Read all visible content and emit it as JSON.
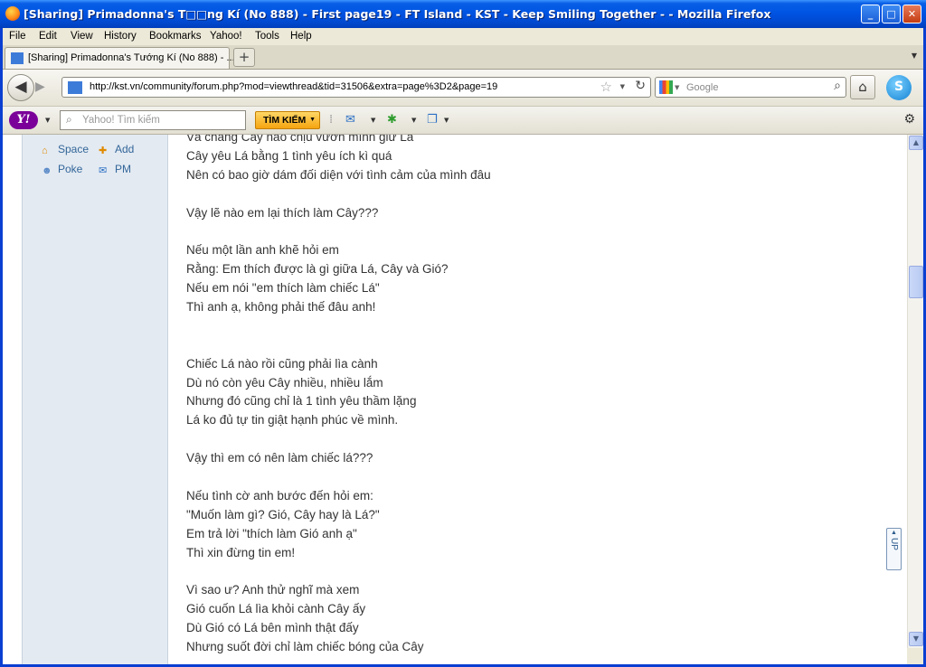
{
  "window": {
    "title": "[Sharing] Primadonna's T□□ng Kí (No 888) - First page19 - FT Island - KST - Keep Smiling Together - - Mozilla Firefox",
    "minimize": "_",
    "maximize": "□",
    "close": "✕"
  },
  "menu": {
    "file": "File",
    "edit": "Edit",
    "view": "View",
    "history": "History",
    "bookmarks": "Bookmarks",
    "yahoo": "Yahoo!",
    "tools": "Tools",
    "help": "Help"
  },
  "tab": {
    "label": "[Sharing] Primadonna's Tướng Kí (No 888) - ...",
    "close": "×",
    "new_tab": "+"
  },
  "nav": {
    "url": "http://kst.vn/community/forum.php?mod=viewthread&tid=31506&extra=page%3D2&page=19",
    "search_placeholder": "Google"
  },
  "yahoo_toolbar": {
    "logo": "Y!",
    "search_placeholder": "Yahoo! Tìm kiếm",
    "search_button": "TÌM KIẾM"
  },
  "sidebar": {
    "items": [
      {
        "label": "Space",
        "icon": "home-icon"
      },
      {
        "label": "Add",
        "icon": "add-friend-icon"
      },
      {
        "label": "Poke",
        "icon": "poke-icon"
      },
      {
        "label": "PM",
        "icon": "mail-icon"
      }
    ]
  },
  "post": {
    "lines": [
      "Và chàng Cây nào chịu vươn mình giữ Lá",
      "Cây yêu Lá bằng 1 tình yêu ích kì quá",
      "Nên có bao giờ dám đối diện với tình cảm của mình đâu",
      "",
      "Vậy lẽ nào em lại thích làm Cây???",
      "",
      "Nếu một lần anh khẽ hỏi em",
      "Rằng: Em thích được là gì giữa Lá, Cây và Gió?",
      "Nếu em nói \"em thích làm chiếc Lá\"",
      "Thì anh ạ, không phải thế đâu anh!",
      "",
      "",
      "Chiếc Lá nào rồi cũng phải lìa cành",
      "Dù nó còn yêu Cây nhiều, nhiều lắm",
      "Nhưng đó cũng chỉ là 1 tình yêu thầm lặng",
      "Lá ko đủ tự tin giật hạnh phúc về mình.",
      "",
      "Vậy thì em có nên làm chiếc lá???",
      "",
      "Nếu tình cờ anh bước đến hỏi em:",
      "\"Muốn làm gì? Gió, Cây hay là Lá?\"",
      "Em trả lời \"thích làm Gió anh ạ\"",
      "Thì xin đừng tin em!",
      "",
      "Vì sao ư? Anh thử nghĩ mà xem",
      "Gió cuốn Lá lìa khỏi cành Cây ấy",
      "Dù Gió có Lá bên mình thật đấy",
      "Nhưng suốt đời chỉ làm chiếc bóng của Cây"
    ]
  },
  "up_button": "UP",
  "colors": {
    "title_bar": "#0054e3",
    "sidebar_bg": "#e3eaf2",
    "link": "#336699",
    "text": "#333333",
    "yahoo_purple": "#7b0099",
    "yahoo_button": "#f5a40f"
  }
}
